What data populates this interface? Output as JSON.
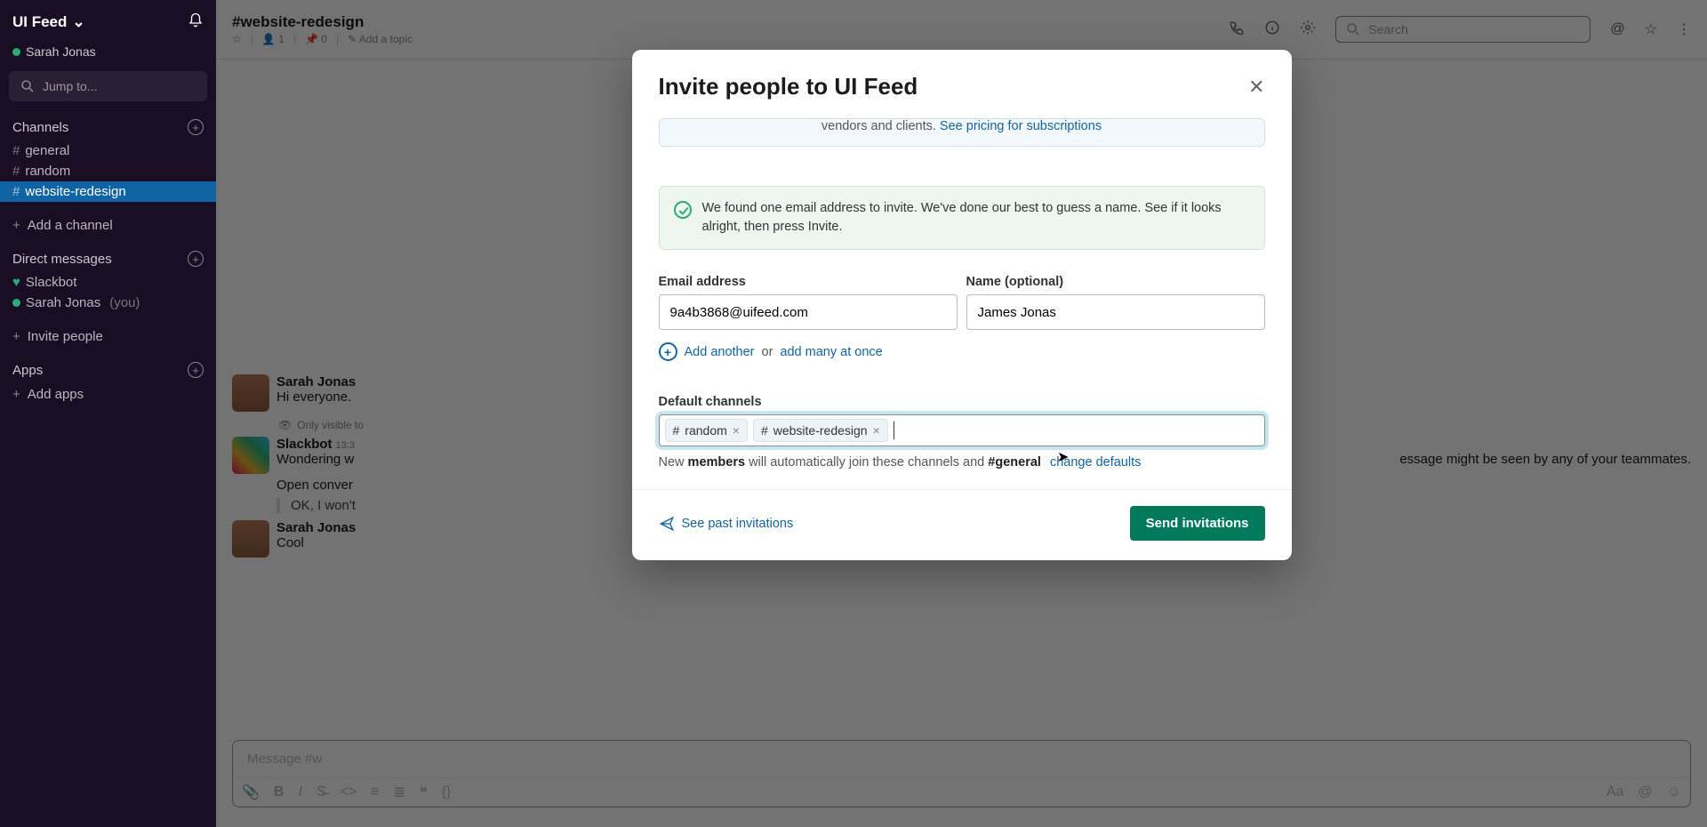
{
  "sidebar": {
    "team_name": "UI Feed",
    "user_name": "Sarah Jonas",
    "jump_to": "Jump to...",
    "channels_label": "Channels",
    "channels": [
      {
        "name": "general"
      },
      {
        "name": "random"
      },
      {
        "name": "website-redesign"
      }
    ],
    "add_channel": "Add a channel",
    "dm_label": "Direct messages",
    "dms": [
      {
        "name": "Slackbot",
        "you": ""
      },
      {
        "name": "Sarah Jonas",
        "you": "(you)"
      }
    ],
    "invite_people": "Invite people",
    "apps_label": "Apps",
    "add_apps": "Add apps"
  },
  "header": {
    "channel": "#website-redesign",
    "members": "1",
    "pins": "0",
    "add_topic": "Add a topic",
    "search_placeholder": "Search"
  },
  "messages": {
    "m1": {
      "author": "Sarah Jonas",
      "text": "Hi everyone."
    },
    "only_visible": "Only visible to",
    "m2": {
      "author": "Slackbot",
      "time": "13:3",
      "text": "Wondering w",
      "text2": "essage might be seen by any of your teammates.",
      "l2": "Open conver",
      "quote": "OK, I won't"
    },
    "m3": {
      "author": "Sarah Jonas",
      "text": "Cool"
    }
  },
  "composer": {
    "placeholder": "Message #w"
  },
  "modal": {
    "title": "Invite people to UI Feed",
    "top_banner_tail": "vendors and clients.",
    "top_banner_link": "See pricing for subscriptions",
    "success": "We found one email address to invite. We've done our best to guess a name. See if it looks alright, then press Invite.",
    "email_label": "Email address",
    "email_value": "9a4b3868@uifeed.com",
    "name_label": "Name (optional)",
    "name_value": "James Jonas",
    "add_another": "Add another",
    "or": "or",
    "add_many": "add many at once",
    "default_label": "Default channels",
    "tokens": [
      {
        "label": "random"
      },
      {
        "label": "website-redesign"
      }
    ],
    "hint_new": "New",
    "hint_members": "members",
    "hint_mid": "will automatically join these channels and",
    "hint_general": "#general",
    "hint_change": "change defaults",
    "past": "See past invitations",
    "send": "Send invitations"
  }
}
